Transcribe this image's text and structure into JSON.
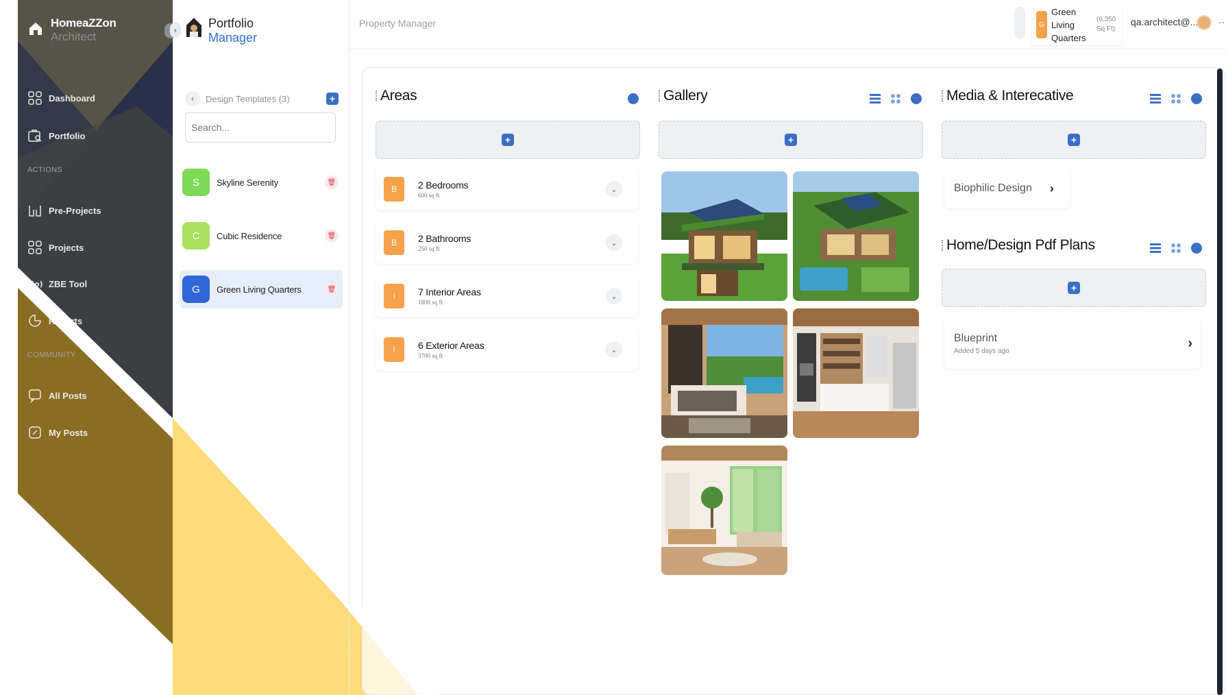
{
  "sidebar": {
    "brand_line1": "HomeaZZon",
    "brand_line2": "Architect",
    "collapse_glyph": "‹",
    "items": [
      {
        "label": "Dashboard",
        "icon": "grid-icon"
      },
      {
        "label": "Portfolio",
        "icon": "portfolio-icon"
      },
      {
        "label": "Pre-Projects",
        "icon": "pre-projects-icon"
      },
      {
        "label": "Projects",
        "icon": "projects-icon"
      },
      {
        "label": "ZBE Tool",
        "icon": "broadcast-icon"
      },
      {
        "label": "Reports",
        "icon": "chart-pie-icon"
      },
      {
        "label": "All Posts",
        "icon": "posts-icon"
      },
      {
        "label": "My Posts",
        "icon": "edit-icon"
      }
    ],
    "section_actions": "ACTIONS",
    "section_community": "COMMUNITY"
  },
  "templates": {
    "title_line1": "Portfolio",
    "title_line2": "Manager",
    "collapse_glyph": "‹",
    "heading": "Design Templates (3)",
    "search_placeholder": "Search...",
    "items": [
      {
        "initial": "S",
        "name": "Skyline Serenity",
        "color": "#7ed957"
      },
      {
        "initial": "C",
        "name": "Cubic Residence",
        "color": "#a8e05f"
      },
      {
        "initial": "G",
        "name": "Green Living Quarters",
        "color": "#2f66d8"
      }
    ]
  },
  "header": {
    "breadcrumb": "Property Manager",
    "property_initial": "G",
    "property_name": "Green Living Quarters",
    "property_size": "(6,350 Sq Ft)",
    "user_email": "qa.architect@...",
    "more": "···"
  },
  "areas": {
    "title": "Areas",
    "items": [
      {
        "badge": "B",
        "name": "2 Bedrooms",
        "size": "600 sq ft"
      },
      {
        "badge": "B",
        "name": "2 Bathrooms",
        "size": "250 sq ft"
      },
      {
        "badge": "I",
        "name": "7 Interior Areas",
        "size": "1800 sq ft"
      },
      {
        "badge": "I",
        "name": "6 Exterior Areas",
        "size": "3700 sq ft"
      }
    ]
  },
  "gallery": {
    "title": "Gallery",
    "images": [
      "eco-house-exterior",
      "eco-house-aerial",
      "bedroom-interior",
      "kitchen-interior",
      "living-room-interior"
    ]
  },
  "media": {
    "title": "Media & Interecative",
    "items": [
      {
        "label": "Biophilic Design"
      }
    ]
  },
  "plans": {
    "title": "Home/Design Pdf Plans",
    "items": [
      {
        "label": "Blueprint",
        "sub": "Added 5 days ago"
      }
    ]
  },
  "colors": {
    "sidebar_bg": "#28304a",
    "gold": "#8a6d22",
    "yellow": "#ffdb7a",
    "accent": "#3b6fc5",
    "orange": "#f6a24a"
  }
}
